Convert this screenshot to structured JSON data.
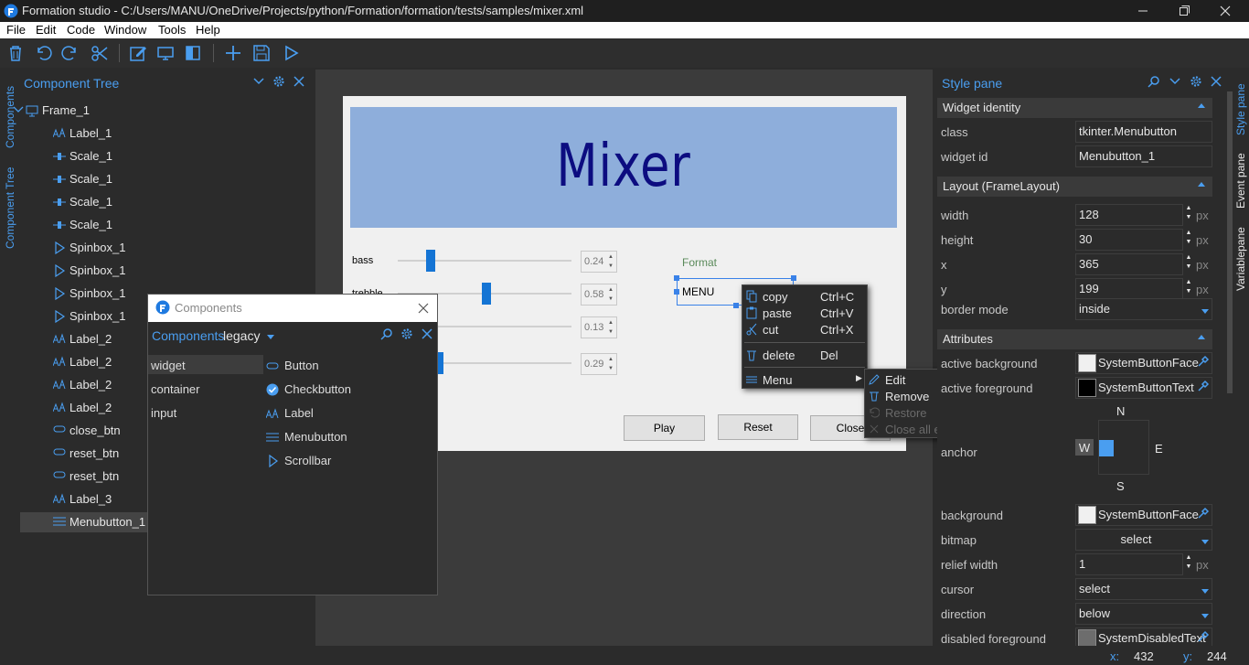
{
  "window": {
    "title": "Formation studio - C:/Users/MANU/OneDrive/Projects/python/Formation/formation/tests/samples/mixer.xml",
    "controls": [
      "minimize-icon",
      "maximize-icon",
      "close-icon"
    ]
  },
  "menubar": {
    "items": [
      "File",
      "Edit",
      "Code",
      "Window",
      "Tools",
      "Help"
    ]
  },
  "toolbar": {
    "icons": [
      "delete-icon",
      "undo-icon",
      "redo-icon",
      "cut-icon",
      "edit-icon",
      "preview-icon",
      "split-view-icon",
      "new-icon",
      "save-icon",
      "run-icon"
    ]
  },
  "left_strip": {
    "tabs": [
      "Components",
      "Component Tree"
    ]
  },
  "component_tree": {
    "title": "Component Tree",
    "items": [
      {
        "label": "Frame_1",
        "icon": "frame-icon",
        "level": 0
      },
      {
        "label": "Label_1",
        "icon": "label-icon",
        "level": 1
      },
      {
        "label": "Scale_1",
        "icon": "scale-icon",
        "level": 1
      },
      {
        "label": "Scale_1",
        "icon": "scale-icon",
        "level": 1
      },
      {
        "label": "Scale_1",
        "icon": "scale-icon",
        "level": 1
      },
      {
        "label": "Scale_1",
        "icon": "scale-icon",
        "level": 1
      },
      {
        "label": "Spinbox_1",
        "icon": "spinbox-icon",
        "level": 1
      },
      {
        "label": "Spinbox_1",
        "icon": "spinbox-icon",
        "level": 1
      },
      {
        "label": "Spinbox_1",
        "icon": "spinbox-icon",
        "level": 1
      },
      {
        "label": "Spinbox_1",
        "icon": "spinbox-icon",
        "level": 1
      },
      {
        "label": "Label_2",
        "icon": "label-icon",
        "level": 1
      },
      {
        "label": "Label_2",
        "icon": "label-icon",
        "level": 1
      },
      {
        "label": "Label_2",
        "icon": "label-icon",
        "level": 1
      },
      {
        "label": "Label_2",
        "icon": "label-icon",
        "level": 1
      },
      {
        "label": "close_btn",
        "icon": "button-icon",
        "level": 1
      },
      {
        "label": "reset_btn",
        "icon": "button-icon",
        "level": 1
      },
      {
        "label": "reset_btn",
        "icon": "button-icon",
        "level": 1
      },
      {
        "label": "Label_3",
        "icon": "label-icon",
        "level": 1
      },
      {
        "label": "Menubutton_1",
        "icon": "menubutton-icon",
        "level": 1,
        "selected": true
      }
    ]
  },
  "design": {
    "banner_title": "Mixer",
    "sliders": [
      {
        "label": "bass",
        "value": "0.24",
        "fraction": 0.24
      },
      {
        "label": "trebble",
        "value": "0.58",
        "fraction": 0.58
      },
      {
        "label": "",
        "value": "0.13",
        "fraction": 0.13
      },
      {
        "label": "",
        "value": "0.29",
        "fraction": 0.29
      }
    ],
    "format_label": "Format",
    "menubutton_text": "MENU",
    "buttons": [
      "Play",
      "Reset",
      "Close"
    ]
  },
  "context_menu": {
    "items": [
      {
        "label": "copy",
        "shortcut": "Ctrl+C",
        "icon": "copy-icon"
      },
      {
        "label": "paste",
        "shortcut": "Ctrl+V",
        "icon": "paste-icon"
      },
      {
        "label": "cut",
        "shortcut": "Ctrl+X",
        "icon": "cut-icon"
      },
      {
        "label": "delete",
        "shortcut": "Del",
        "icon": "delete-icon"
      },
      {
        "label": "Menu",
        "shortcut": "",
        "icon": "menu-icon"
      }
    ]
  },
  "submenu": {
    "items": [
      {
        "label": "Edit",
        "icon": "edit-icon",
        "enabled": true
      },
      {
        "label": "Remove",
        "icon": "trash-icon",
        "enabled": true
      },
      {
        "label": "Restore",
        "icon": "restore-icon",
        "enabled": false
      },
      {
        "label": "Close all editors",
        "icon": "close-icon",
        "enabled": false
      }
    ]
  },
  "components_popup": {
    "title": "Components",
    "header_label": "Components",
    "selector_value": "legacy",
    "groups": [
      "widget",
      "container",
      "input"
    ],
    "widgets": [
      {
        "label": "Button",
        "icon": "button-icon"
      },
      {
        "label": "Checkbutton",
        "icon": "checkbutton-icon"
      },
      {
        "label": "Label",
        "icon": "label-icon"
      },
      {
        "label": "Menubutton",
        "icon": "menubutton-icon"
      },
      {
        "label": "Scrollbar",
        "icon": "scrollbar-icon"
      }
    ]
  },
  "style_pane": {
    "title": "Style pane",
    "widget_identity": {
      "section": "Widget identity",
      "class_label": "class",
      "class_value": "tkinter.Menubutton",
      "id_label": "widget id",
      "id_value": "Menubutton_1"
    },
    "layout": {
      "section": "Layout (FrameLayout)",
      "fields": [
        {
          "label": "width",
          "value": "128",
          "unit": "px"
        },
        {
          "label": "height",
          "value": "30",
          "unit": "px"
        },
        {
          "label": "x",
          "value": "365",
          "unit": "px"
        },
        {
          "label": "y",
          "value": "199",
          "unit": "px"
        }
      ],
      "border_mode_label": "border mode",
      "border_mode_value": "inside"
    },
    "attributes": {
      "section": "Attributes",
      "active_background_label": "active background",
      "active_background_value": "SystemButtonFace",
      "active_background_color": "#f0f0f0",
      "active_foreground_label": "active foreground",
      "active_foreground_value": "SystemButtonText",
      "active_foreground_color": "#000000",
      "anchor_label": "anchor",
      "anchor_n": "N",
      "anchor_s": "S",
      "anchor_e": "E",
      "anchor_w": "W",
      "background_label": "background",
      "background_value": "SystemButtonFace",
      "background_color": "#f0f0f0",
      "bitmap_label": "bitmap",
      "bitmap_value": "select",
      "relief_width_label": "relief width",
      "relief_width_value": "1",
      "relief_width_unit": "px",
      "cursor_label": "cursor",
      "cursor_value": "select",
      "direction_label": "direction",
      "direction_value": "below",
      "disabled_foreground_label": "disabled foreground",
      "disabled_foreground_value": "SystemDisabledText",
      "disabled_foreground_color": "#6d6d6d"
    }
  },
  "right_strip": {
    "tabs": [
      "Style pane",
      "Event pane",
      "Variablepane"
    ]
  },
  "status": {
    "x_label": "x:",
    "x_value": "432",
    "y_label": "y:",
    "y_value": "244"
  },
  "colors": {
    "accent": "#4a9ef0",
    "panel_bg": "#2b2b2b",
    "banner": "#8eaedb",
    "banner_text": "#0c0c80",
    "slider_thumb": "#1474d4"
  }
}
